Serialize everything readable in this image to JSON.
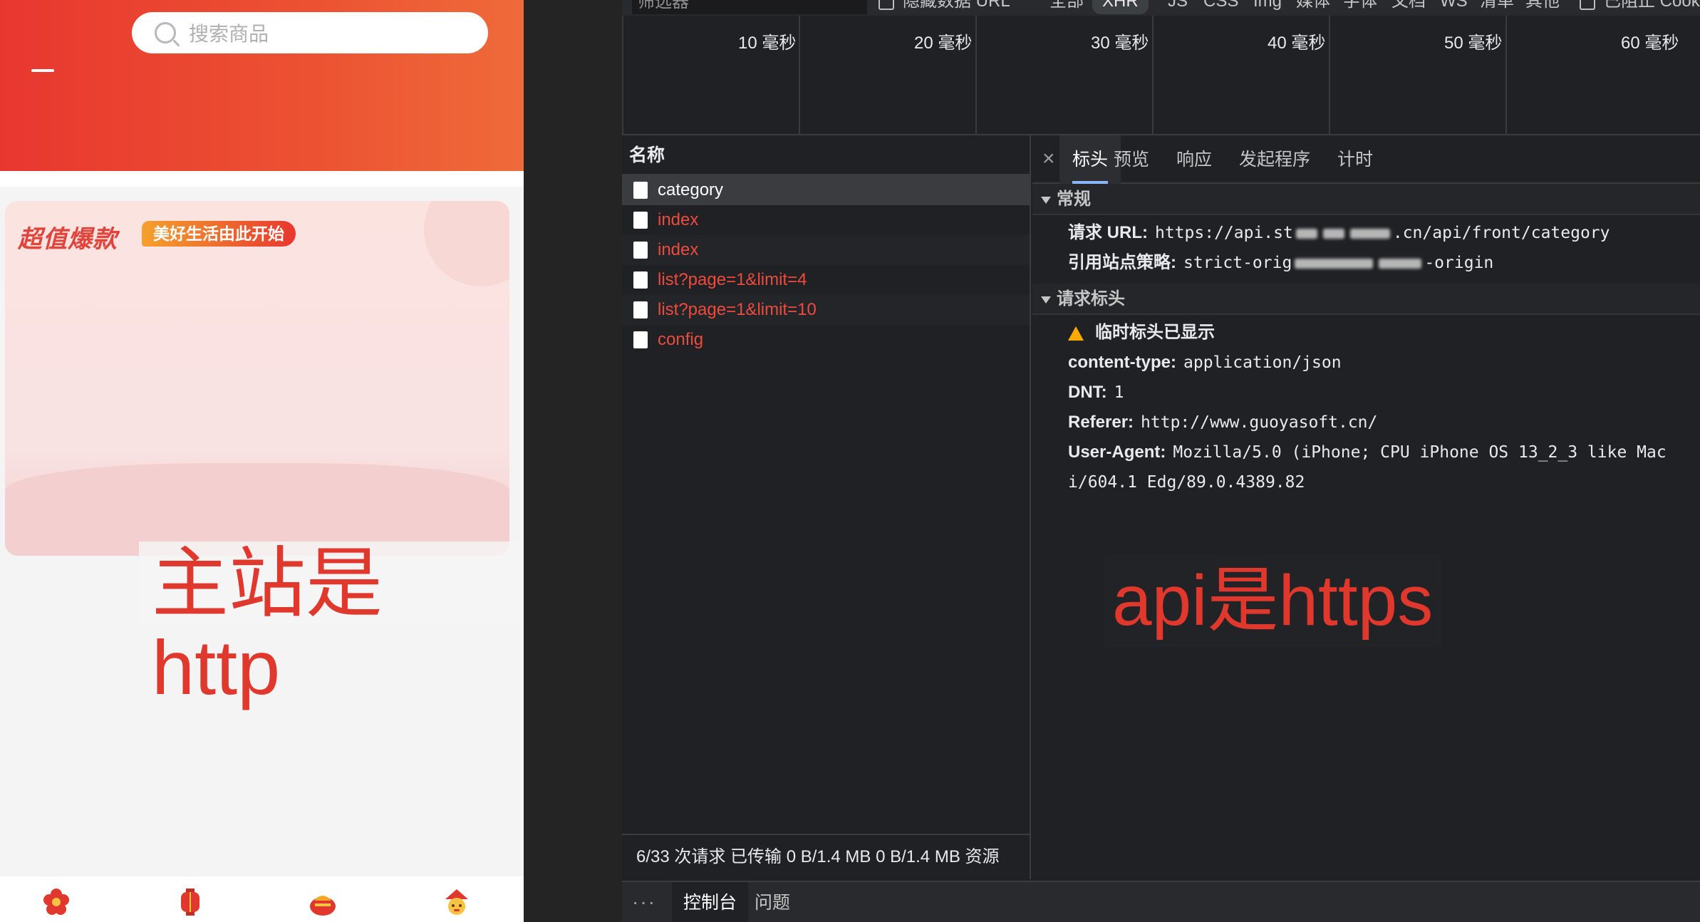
{
  "app": {
    "search_placeholder": "搜索商品",
    "hot_title": "超值爆款",
    "hot_tag": "美好生活由此开始",
    "overlay_http": "主站是http",
    "tabs": [
      {
        "icon": "flower-icon"
      },
      {
        "icon": "lantern-icon"
      },
      {
        "icon": "bag-icon"
      },
      {
        "icon": "cat-icon"
      }
    ],
    "colors": {
      "header_start": "#e8372f",
      "header_end": "#ee6b3a",
      "accent": "#e0382c"
    }
  },
  "devtools": {
    "filter_placeholder": "筛选器",
    "hide_data_url": "隐藏数据 URL",
    "types": [
      "全部",
      "XHR",
      "JS",
      "CSS",
      "Img",
      "媒体",
      "字体",
      "文档",
      "WS",
      "清单",
      "其他"
    ],
    "blocked_cookies": "已阻止 Cookie",
    "timeline_ticks": [
      "10 毫秒",
      "20 毫秒",
      "30 毫秒",
      "40 毫秒",
      "50 毫秒",
      "60 毫秒"
    ],
    "name_header": "名称",
    "requests": [
      {
        "name": "category",
        "status": "selected"
      },
      {
        "name": "index",
        "status": "error"
      },
      {
        "name": "index",
        "status": "error"
      },
      {
        "name": "list?page=1&limit=4",
        "status": "error"
      },
      {
        "name": "list?page=1&limit=10",
        "status": "error"
      },
      {
        "name": "config",
        "status": "error"
      }
    ],
    "summary": "6/33 次请求  已传输 0 B/1.4 MB  0 B/1.4 MB 资源",
    "detail_tabs": [
      "标头",
      "预览",
      "响应",
      "发起程序",
      "计时"
    ],
    "general": {
      "title": "常规",
      "request_url_label": "请求 URL:",
      "request_url_start": "https://api.st",
      "request_url_end": ".cn/api/front/category",
      "referrer_policy_label": "引用站点策略:",
      "referrer_policy_start": "strict-orig",
      "referrer_policy_end": "-origin"
    },
    "request_headers": {
      "title": "请求标头",
      "warning": "临时标头已显示",
      "rows": [
        {
          "key": "content-type:",
          "value": "application/json"
        },
        {
          "key": "DNT:",
          "value": "1"
        },
        {
          "key": "Referer:",
          "value": "http://www.guoyasoft.cn/"
        },
        {
          "key": "User-Agent:",
          "value": "Mozilla/5.0 (iPhone; CPU iPhone OS 13_2_3 like Mac"
        }
      ],
      "ua_continued": "i/604.1 Edg/89.0.4389.82"
    },
    "overlay_https": "api是https",
    "drawer": {
      "more": "⋮",
      "console": "控制台",
      "issues": "问题"
    }
  }
}
